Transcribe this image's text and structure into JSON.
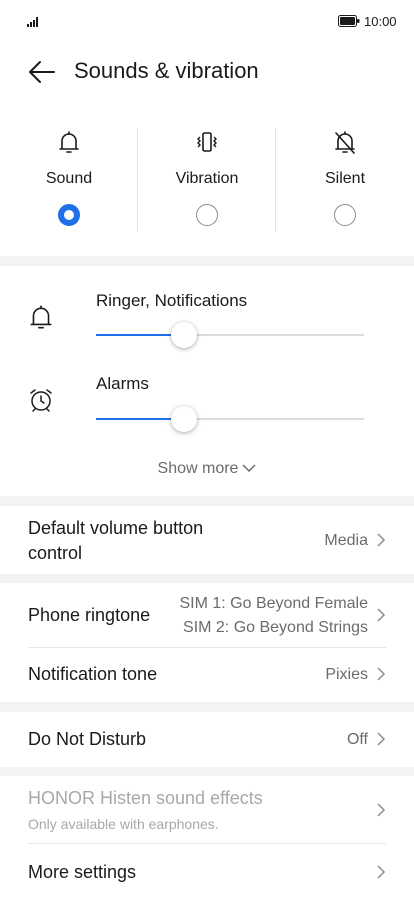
{
  "status_bar": {
    "time": "10:00"
  },
  "header": {
    "title": "Sounds & vibration"
  },
  "modes": [
    {
      "label": "Sound",
      "selected": true
    },
    {
      "label": "Vibration",
      "selected": false
    },
    {
      "label": "Silent",
      "selected": false
    }
  ],
  "volume": {
    "items": [
      {
        "label": "Ringer, Notifications",
        "level": 0.33
      },
      {
        "label": "Alarms",
        "level": 0.33
      }
    ],
    "show_more": "Show more"
  },
  "settings": {
    "default_volume": {
      "title": "Default volume button control",
      "value": "Media"
    },
    "phone_ringtone": {
      "title": "Phone ringtone",
      "sim1": "SIM 1: Go Beyond Female",
      "sim2": "SIM 2: Go Beyond Strings"
    },
    "notification_tone": {
      "title": "Notification tone",
      "value": "Pixies"
    },
    "do_not_disturb": {
      "title": "Do Not Disturb",
      "value": "Off"
    },
    "histen": {
      "title": "HONOR Histen sound effects",
      "subtitle": "Only available with earphones."
    },
    "more_settings": {
      "title": "More settings"
    }
  },
  "colors": {
    "accent": "#1f6fe8",
    "background": "#f1f3f5"
  }
}
